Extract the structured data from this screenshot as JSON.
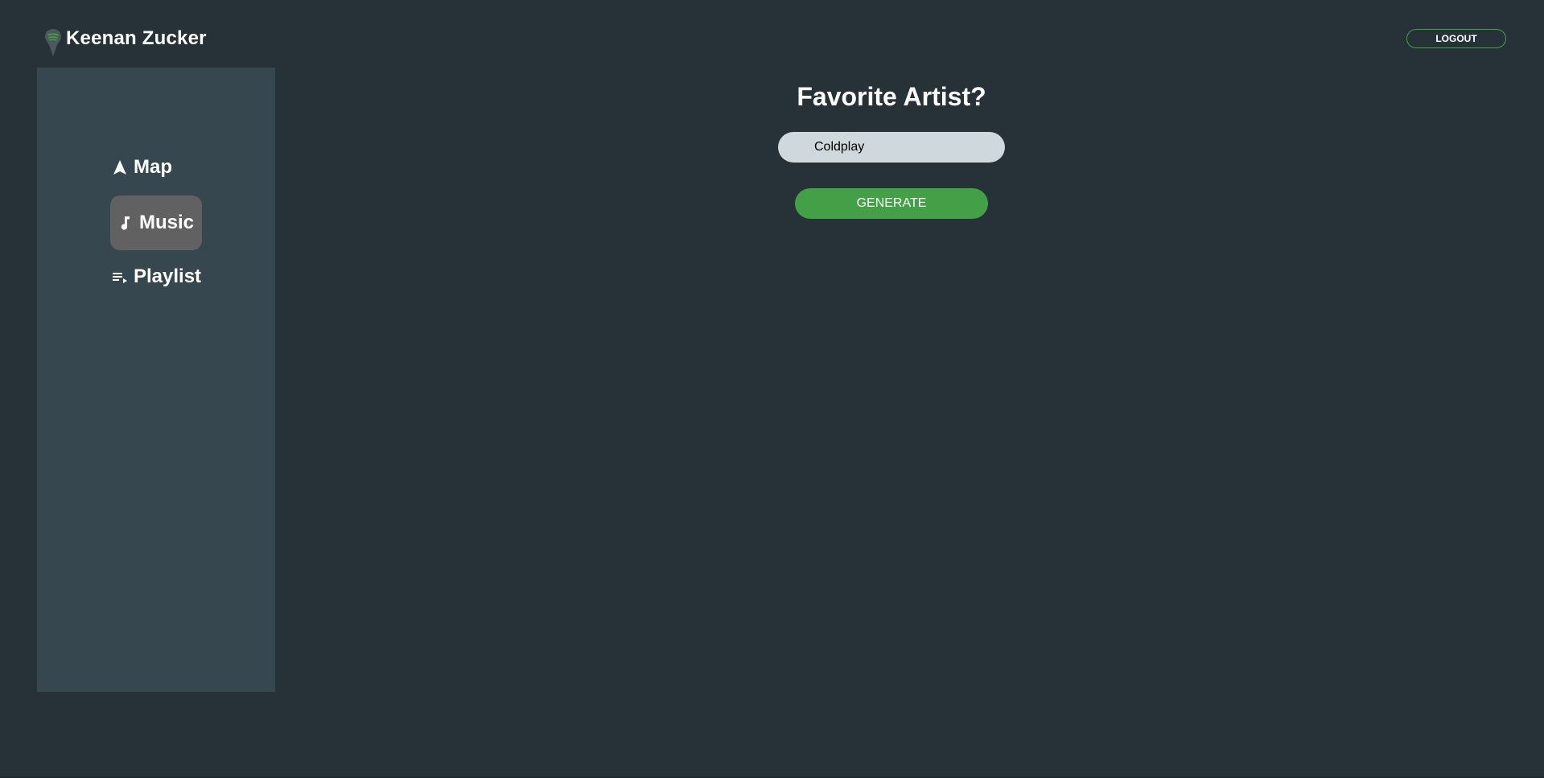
{
  "header": {
    "user_name": "Keenan Zucker",
    "logo_icon": "spotify-map-pin-icon",
    "logout_label": "LOGOUT"
  },
  "sidebar": {
    "items": [
      {
        "label": "Map",
        "icon": "navigation-arrow-icon",
        "active": false
      },
      {
        "label": "Music",
        "icon": "music-note-icon",
        "active": true
      },
      {
        "label": "Playlist",
        "icon": "playlist-icon",
        "active": false
      }
    ]
  },
  "main": {
    "title": "Favorite Artist?",
    "artist_input_value": "Coldplay",
    "generate_label": "GENERATE"
  },
  "colors": {
    "background": "#263238",
    "sidebar": "#37474f",
    "active_item": "#616161",
    "accent_green": "#43a047",
    "input_bg": "#cfd8dc"
  }
}
